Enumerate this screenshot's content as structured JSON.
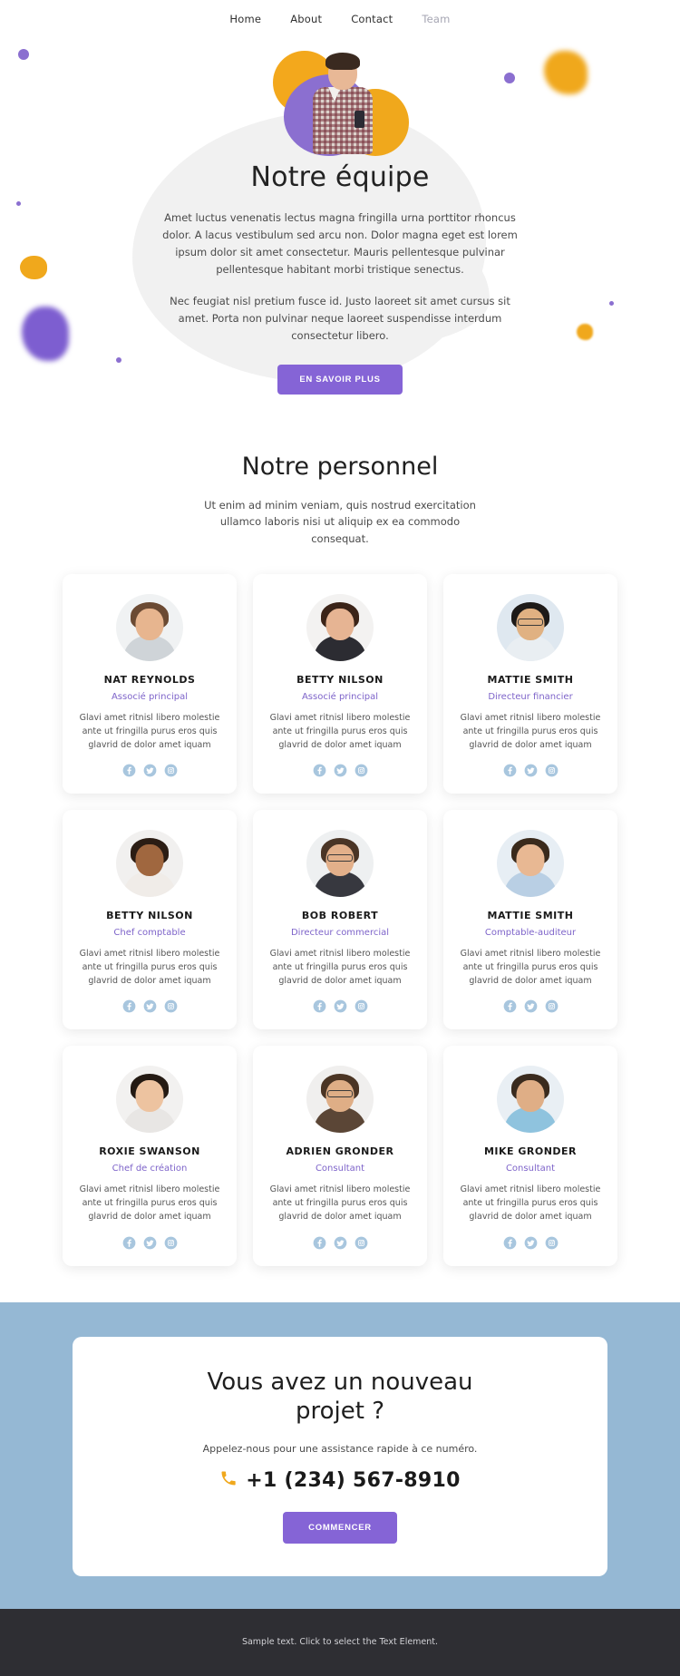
{
  "nav": {
    "items": [
      {
        "label": "Home",
        "active": false
      },
      {
        "label": "About",
        "active": false
      },
      {
        "label": "Contact",
        "active": false
      },
      {
        "label": "Team",
        "active": true
      }
    ]
  },
  "hero": {
    "title": "Notre équipe",
    "paragraph1": "Amet luctus venenatis lectus magna fringilla urna porttitor rhoncus dolor. A lacus vestibulum sed arcu non. Dolor magna eget est lorem ipsum dolor sit amet consectetur. Mauris pellentesque pulvinar pellentesque habitant morbi tristique senectus.",
    "paragraph2": "Nec feugiat nisl pretium fusce id. Justo laoreet sit amet cursus sit amet. Porta non pulvinar neque laoreet suspendisse interdum consectetur libero.",
    "button_label": "EN SAVOIR PLUS"
  },
  "staff": {
    "title": "Notre personnel",
    "subtitle": "Ut enim ad minim veniam, quis nostrud exercitation ullamco laboris nisi ut aliquip ex ea commodo consequat.",
    "description": "Glavi amet ritnisl libero molestie ante ut fringilla purus eros quis glavrid de dolor amet iquam",
    "social_icons": [
      "facebook-icon",
      "twitter-icon",
      "instagram-icon"
    ],
    "members": [
      {
        "name": "NAT REYNOLDS",
        "role": "Associé principal",
        "desc": "Glavi amet ritnisl libero molestie ante ut fringilla purus eros quis glavrid de dolor amet iquam"
      },
      {
        "name": "BETTY NILSON",
        "role": "Associé principal",
        "desc": "Glavi amet ritnisl libero molestie ante ut fringilla purus eros quis glavrid de dolor amet iquam"
      },
      {
        "name": "MATTIE SMITH",
        "role": "Directeur financier",
        "desc": "Glavi amet ritnisl libero molestie ante ut fringilla purus eros quis glavrid de dolor amet iquam"
      },
      {
        "name": "BETTY NILSON",
        "role": "Chef comptable",
        "desc": "Glavi amet ritnisl libero molestie ante ut fringilla purus eros quis glavrid de dolor amet iquam"
      },
      {
        "name": "BOB ROBERT",
        "role": "Directeur commercial",
        "desc": "Glavi amet ritnisl libero molestie ante ut fringilla purus eros quis glavrid de dolor amet iquam"
      },
      {
        "name": "MATTIE SMITH",
        "role": "Comptable-auditeur",
        "desc": "Glavi amet ritnisl libero molestie ante ut fringilla purus eros quis glavrid de dolor amet iquam"
      },
      {
        "name": "ROXIE SWANSON",
        "role": "Chef de création",
        "desc": "Glavi amet ritnisl libero molestie ante ut fringilla purus eros quis glavrid de dolor amet iquam"
      },
      {
        "name": "ADRIEN GRONDER",
        "role": "Consultant",
        "desc": "Glavi amet ritnisl libero molestie ante ut fringilla purus eros quis glavrid de dolor amet iquam"
      },
      {
        "name": "MIKE GRONDER",
        "role": "Consultant",
        "desc": "Glavi amet ritnisl libero molestie ante ut fringilla purus eros quis glavrid de dolor amet iquam"
      }
    ]
  },
  "cta": {
    "title": "Vous avez un nouveau projet ?",
    "note": "Appelez-nous pour une assistance rapide à ce numéro.",
    "phone": "+1 (234) 567-8910",
    "phone_icon": "phone-icon",
    "button_label": "COMMENCER"
  },
  "footer": {
    "text": "Sample text. Click to select the Text Element."
  },
  "colors": {
    "purple": "#8564d6",
    "role_purple": "#7d63c9",
    "band_blue": "#95b8d4",
    "social_blue": "#a8c6de",
    "yellow": "#f0a81c",
    "footer_bg": "#2e2e33"
  }
}
